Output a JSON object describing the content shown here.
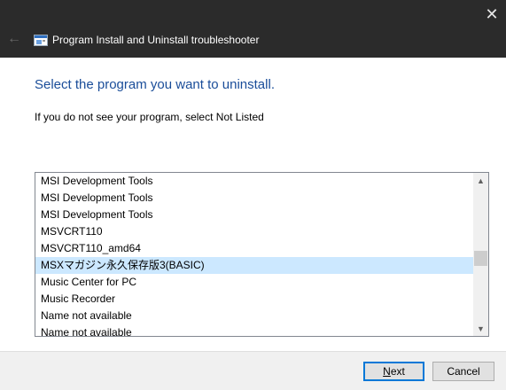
{
  "window": {
    "title": "Program Install and Uninstall troubleshooter",
    "close_glyph": "✕",
    "back_glyph": "←"
  },
  "main": {
    "heading": "Select the program you want to uninstall.",
    "instruction": "If you do not see your program, select Not Listed"
  },
  "programs": {
    "items": [
      "MSI Development Tools",
      "MSI Development Tools",
      "MSI Development Tools",
      "MSVCRT110",
      "MSVCRT110_amd64",
      "MSXマガジン永久保存版3(BASIC)",
      "Music Center for PC",
      "Music Recorder",
      "Name not available",
      "Name not available"
    ],
    "selected_index": 5
  },
  "footer": {
    "next_label_first": "N",
    "next_label_rest": "ext",
    "cancel_label": "Cancel"
  },
  "colors": {
    "titlebar": "#2b2b2b",
    "heading": "#1a4d99",
    "selection": "#cce8ff",
    "accent": "#0078d7"
  }
}
